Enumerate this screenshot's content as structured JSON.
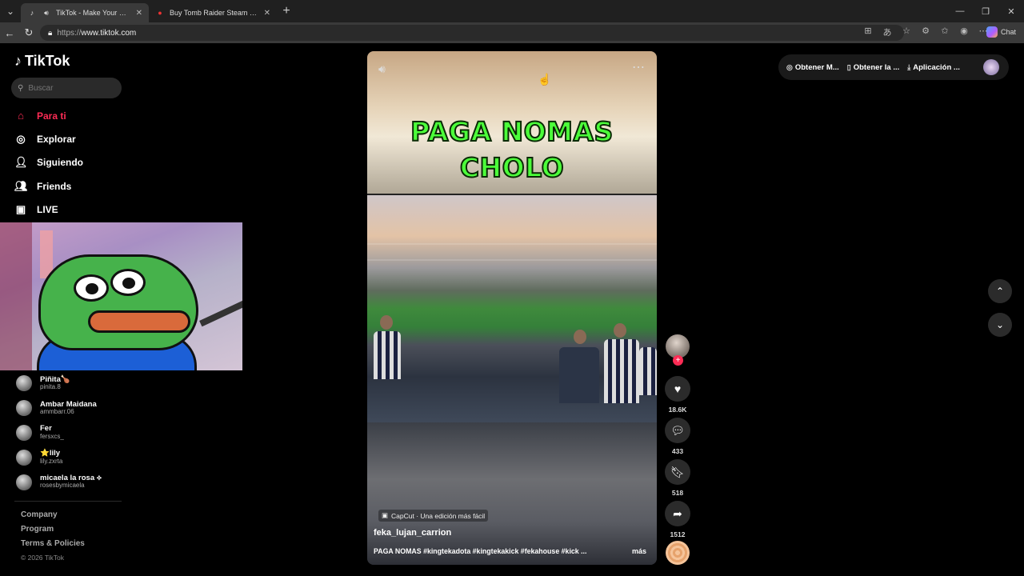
{
  "browser": {
    "tabs": [
      {
        "title": "TikTok - Make Your Day",
        "favicon": "tiktok-icon"
      },
      {
        "title": "Buy Tomb Raider Steam key PC! Ch",
        "favicon": "store-icon"
      }
    ],
    "url_protocol": "https://",
    "url_host": "www.tiktok.com",
    "chat_label": "Chat"
  },
  "brand": {
    "name": "TikTok"
  },
  "search": {
    "placeholder": "Buscar"
  },
  "nav": {
    "items": [
      {
        "label": "Para ti",
        "icon": "home-icon",
        "active": true
      },
      {
        "label": "Explorar",
        "icon": "compass-icon"
      },
      {
        "label": "Siguiendo",
        "icon": "following-icon"
      },
      {
        "label": "Friends",
        "icon": "friends-icon"
      },
      {
        "label": "LIVE",
        "icon": "live-icon"
      }
    ]
  },
  "following": [
    {
      "name": "Piñita🍗",
      "handle": "pinita.8"
    },
    {
      "name": "Ambar Maidana",
      "handle": "ammbarr.06"
    },
    {
      "name": "Fer",
      "handle": "fersxcs_"
    },
    {
      "name": "⭐lily",
      "handle": "lily.zxrta"
    },
    {
      "name": "micaela la rosa ⟡",
      "handle": "rosesbymicaela"
    }
  ],
  "footer": {
    "links": [
      "Company",
      "Program",
      "Terms & Policies"
    ],
    "copyright": "© 2026 TikTok"
  },
  "video": {
    "overlay_line1": "PAGA NOMAS",
    "overlay_line2": "CHOLO",
    "capcut_label": "CapCut · Una edición más fácil",
    "author": "feka_lujan_carrion",
    "caption": "PAGA NOMAS #kingtekadota #kingtekakick #fekahouse #kick ...",
    "more_label": "más"
  },
  "actions": {
    "likes": "18.6K",
    "comments": "433",
    "saves": "518",
    "shares": "1512"
  },
  "topbar": {
    "coins": "Obtener M...",
    "app": "Obtener la ...",
    "download": "Aplicación ..."
  }
}
